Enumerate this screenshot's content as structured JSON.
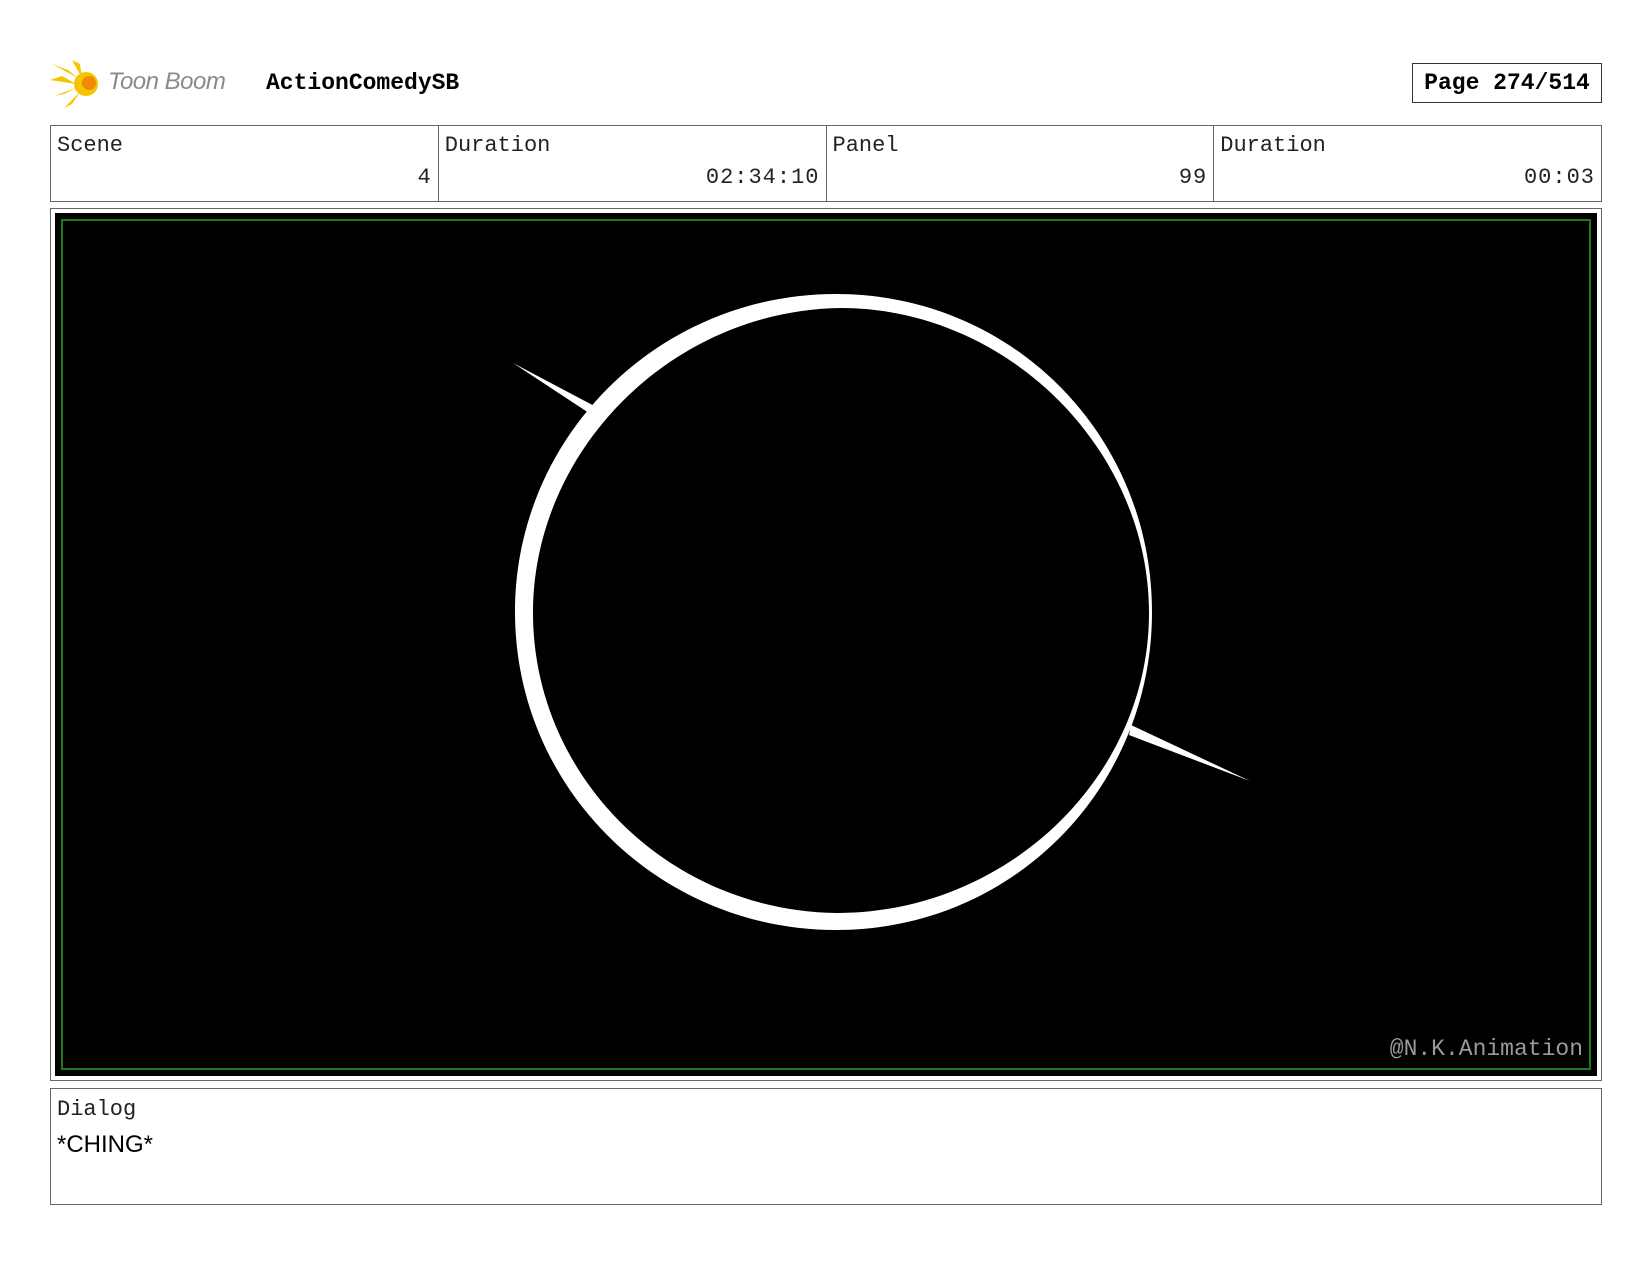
{
  "header": {
    "logo_text": "Toon Boom",
    "project_title": "ActionComedySB",
    "page_label": "Page 274/514"
  },
  "info": {
    "scene_label": "Scene",
    "scene_value": "4",
    "scene_duration_label": "Duration",
    "scene_duration_value": "02:34:10",
    "panel_label": "Panel",
    "panel_value": "99",
    "panel_duration_label": "Duration",
    "panel_duration_value": "00:03"
  },
  "panel": {
    "watermark": "@N.K.Animation",
    "background_color": "#000000",
    "frame_color": "#1c7a1c",
    "drawing_color": "#ffffff"
  },
  "dialog": {
    "label": "Dialog",
    "text": "*CHING*"
  },
  "icons": {
    "logo": "toon-boom-sun-icon"
  },
  "colors": {
    "logo_yellow": "#f5c400",
    "logo_orange": "#f08a00"
  }
}
